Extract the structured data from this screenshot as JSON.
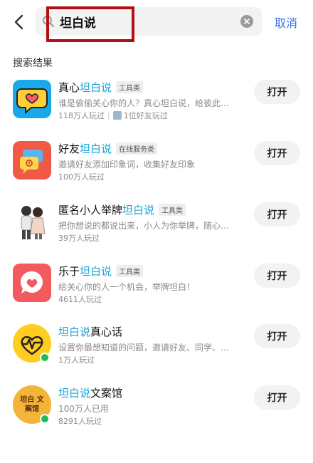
{
  "search": {
    "query": "坦白说",
    "cancel_label": "取消"
  },
  "section_title": "搜索结果",
  "results": [
    {
      "title_pre": "真心",
      "title_hl": "坦白说",
      "title_post": "",
      "tag": "工具类",
      "desc": "谁是偷偷关心你的人？真心坦白说，给彼此…",
      "meta1": "118万人玩过",
      "meta2": "1位好友玩过",
      "button": "打开"
    },
    {
      "title_pre": "好友",
      "title_hl": "坦白说",
      "title_post": "",
      "tag": "在线服务类",
      "desc": "邀请好友添加印象词，收集好友印象",
      "meta1": "100万人玩过",
      "button": "打开"
    },
    {
      "title_pre": "匿名小人举牌",
      "title_hl": "坦白说",
      "title_post": "",
      "tag": "工具类",
      "desc": "把你想说的都说出来，小人为你举牌，随心…",
      "meta1": "39万人玩过",
      "button": "打开"
    },
    {
      "title_pre": "乐于",
      "title_hl": "坦白说",
      "title_post": "",
      "tag": "工具类",
      "desc": "给关心你的人一个机会，举牌坦白！",
      "meta1": "4611人玩过",
      "button": "打开"
    },
    {
      "title_pre": "",
      "title_hl": "坦白说",
      "title_post": "真心话",
      "desc": "设置你最想知道的问题，邀请好友、同学、…",
      "meta1": "1万人玩过",
      "button": "打开"
    },
    {
      "title_pre": "",
      "title_hl": "坦白说",
      "title_post": "文案馆",
      "desc": "100万人已用",
      "meta1": "8291人玩过",
      "button": "打开",
      "icon_text": "坦白 文案馆"
    }
  ]
}
